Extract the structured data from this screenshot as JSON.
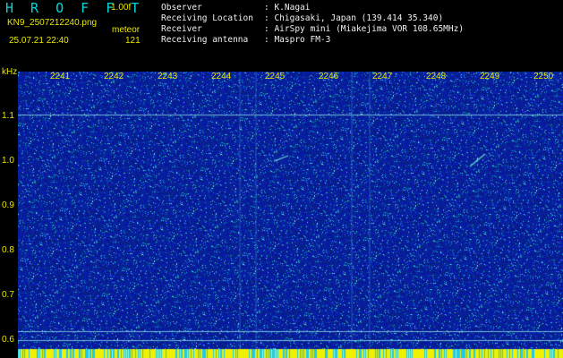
{
  "header": {
    "title": "H R O F F T",
    "version": "1.00f",
    "filename": "KN9_2507212240.png",
    "mode": "meteor",
    "datetime": "25.07.21 22:40",
    "count": "121",
    "info": [
      {
        "label": "Observer",
        "value": ": K.Nagai"
      },
      {
        "label": "Receiving Location",
        "value": ": Chigasaki, Japan (139.414 35.340)"
      },
      {
        "label": "Receiver",
        "value": ": AirSpy mini (Miakejima VOR 108.65MHz)"
      },
      {
        "label": "Receiving antenna",
        "value": ": Maspro FM-3"
      }
    ]
  },
  "axes": {
    "unit": "kHz",
    "x_ticks": [
      "2241",
      "2242",
      "2243",
      "2244",
      "2245",
      "2246",
      "2247",
      "2248",
      "2249",
      "2250"
    ],
    "y_ticks": [
      "1.1",
      "1.0",
      "0.9",
      "0.8",
      "0.7",
      "0.6"
    ]
  },
  "colors": {
    "background": "#000000",
    "spectrum": "#1020a0",
    "label": "#e8e800",
    "title": "#00d8d8"
  }
}
